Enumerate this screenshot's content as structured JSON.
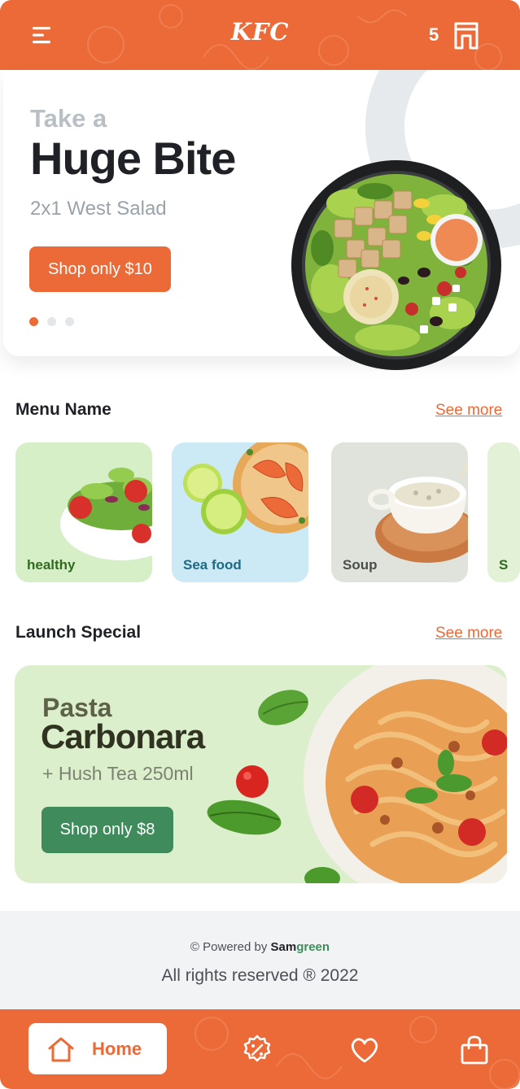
{
  "header": {
    "logo": "KFC",
    "cart_count": "5"
  },
  "hero": {
    "kicker": "Take a",
    "title": "Huge Bite",
    "subtitle": "2x1 West Salad",
    "button": "Shop only $10",
    "carousel_total": 3,
    "carousel_active": 1
  },
  "menu_section": {
    "title": "Menu Name",
    "see_more": "See more",
    "categories": [
      {
        "label": "healthy",
        "bg": "#d7efc7",
        "color": "#2f6b1f"
      },
      {
        "label": "Sea food",
        "bg": "#cbeaf6",
        "color": "#1d6a84"
      },
      {
        "label": "Soup",
        "bg": "#dfe3dc",
        "color": "#4a4f4c"
      },
      {
        "label": "S",
        "bg": "#e3f2d6",
        "color": "#2f6b1f"
      }
    ]
  },
  "launch_section": {
    "title": "Launch Special",
    "see_more": "See more"
  },
  "promo": {
    "kicker": "Pasta",
    "title": "Carbonara",
    "subtitle": "+ Hush Tea 250ml",
    "button": "Shop only $8"
  },
  "footer": {
    "powered_prefix": "© Powered by",
    "brand_a": "Sam",
    "brand_b": "green",
    "rights": "All rights reserved ® 2022"
  },
  "nav": {
    "home": "Home"
  },
  "colors": {
    "brand": "#ec6a37",
    "green": "#3f8b5b",
    "promo_bg": "#dcefcd"
  },
  "icons": [
    "menu-icon",
    "cart-icon",
    "home-icon",
    "discount-icon",
    "heart-icon",
    "bag-icon"
  ]
}
